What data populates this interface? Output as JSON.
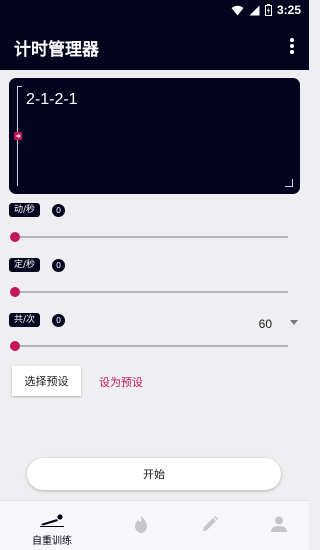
{
  "status_bar": {
    "time": "3:25",
    "icons": [
      "wifi-icon",
      "signal-icon",
      "battery-icon"
    ]
  },
  "app_bar": {
    "title": "计时管理器",
    "menu_icon": "more-vert-icon"
  },
  "editor": {
    "text": "2-1-2-1"
  },
  "sliders": [
    {
      "label": "动/秒",
      "count": "0",
      "value_fraction": 0.0
    },
    {
      "label": "定/秒",
      "count": "0",
      "value_fraction": 0.0
    },
    {
      "label": "共/次",
      "count": "0",
      "value_fraction": 0.0
    }
  ],
  "select": {
    "value": "60"
  },
  "actions": {
    "choose_preset": "选择预设",
    "save_preset": "设为预设",
    "start": "开始"
  },
  "bottom_nav": {
    "items": [
      {
        "label": "自重训练",
        "icon": "exercise-icon",
        "active": true
      },
      {
        "label": "",
        "icon": "fire-icon",
        "active": false
      },
      {
        "label": "",
        "icon": "pencil-icon",
        "active": false
      },
      {
        "label": "",
        "icon": "person-icon",
        "active": false
      }
    ]
  },
  "colors": {
    "primary_dark": "#05041e",
    "accent": "#c2185b",
    "background": "#efeef0"
  }
}
